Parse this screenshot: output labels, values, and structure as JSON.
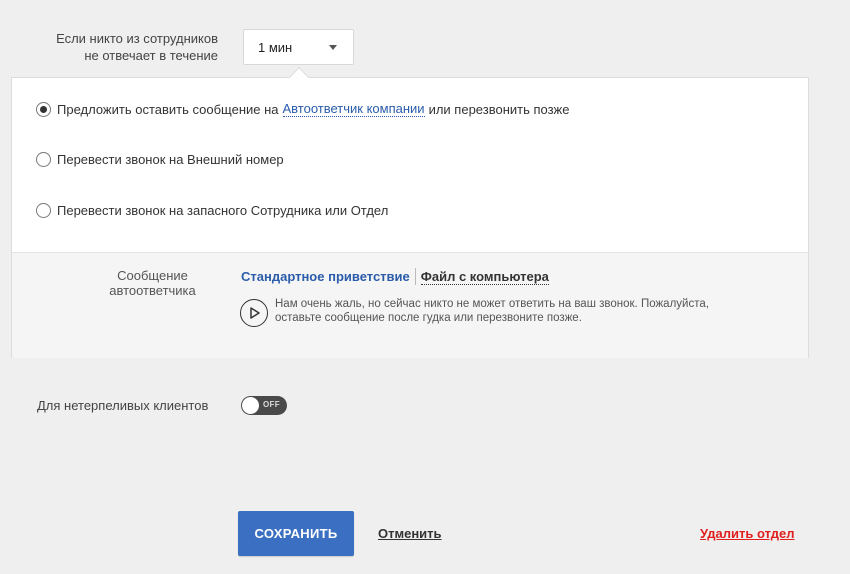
{
  "timeout": {
    "label_line1": "Если никто из сотрудников",
    "label_line2": "не отвечает в течение",
    "selected": "1 мин"
  },
  "options": [
    {
      "prefix": "Предложить оставить сообщение на",
      "link": "Автоответчик компании",
      "suffix": "или перезвонить позже",
      "checked": true
    },
    {
      "label": "Перевести звонок на Внешний номер",
      "checked": false
    },
    {
      "label": "Перевести звонок на запасного Сотрудника или Отдел",
      "checked": false
    }
  ],
  "message": {
    "label_line1": "Сообщение",
    "label_line2": "автоответчика",
    "tab_standard": "Стандартное приветствие",
    "tab_file": "Файл с компьютера",
    "text_line1": "Нам очень жаль, но сейчас никто не может ответить на ваш звонок. Пожалуйста,",
    "text_line2": "оставьте сообщение после гудка или перезвоните позже."
  },
  "impatient": {
    "label": "Для нетерпеливых клиентов",
    "toggle_state": "OFF"
  },
  "footer": {
    "save_label": "СОХРАНИТЬ",
    "cancel_label": "Отменить",
    "delete_label": "Удалить отдел"
  },
  "colors": {
    "accent": "#3a6fc1",
    "link": "#2a5caa",
    "danger": "#e0201e",
    "background": "#efefef"
  }
}
